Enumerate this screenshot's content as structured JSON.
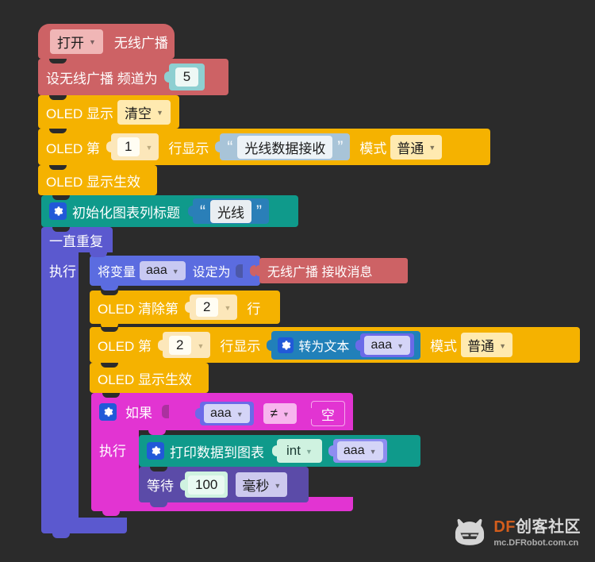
{
  "workspace": {
    "background_color": "#2b2b2b"
  },
  "blocks": {
    "radio_on": {
      "state_label": "打开",
      "title": "无线广播",
      "color": "#cd6265"
    },
    "radio_channel": {
      "prefix": "设无线广播  频道为",
      "channel": "5",
      "color": "#cd6265",
      "socket_color": "#8ecfd1"
    },
    "oled_display": {
      "prefix": "OLED 显示",
      "mode": "清空",
      "color": "#f5b200"
    },
    "oled_line1": {
      "prefix": "OLED 第",
      "line": "1",
      "mid": "行显示",
      "text": "光线数据接收",
      "mode_label": "模式",
      "mode": "普通",
      "color": "#f5b200",
      "string_color": "#a8c4d8"
    },
    "oled_flush1": {
      "label": "OLED 显示生效",
      "color": "#f5b200"
    },
    "chart_init": {
      "label": "初始化图表列标题",
      "title": "光线",
      "color": "#0f9a8b",
      "string_color": "#2a7fb8"
    },
    "repeat_forever": {
      "label": "一直重复",
      "do_label": "执行",
      "color": "#5b59cf"
    },
    "set_variable": {
      "prefix": "将变量",
      "variable": "aaa",
      "mid": "设定为",
      "color": "#5b6ce0",
      "field_color": "#c8c9f2"
    },
    "radio_receive": {
      "label": "无线广播  接收消息",
      "color": "#cd6265"
    },
    "oled_clear_line": {
      "prefix": "OLED 清除第",
      "line": "2",
      "suffix": "行",
      "color": "#f5b200"
    },
    "oled_line2": {
      "prefix": "OLED 第",
      "line": "2",
      "mid": "行显示",
      "mode_label": "模式",
      "mode": "普通",
      "color": "#f5b200"
    },
    "to_text": {
      "label": "转为文本",
      "variable": "aaa",
      "color": "#2180b9",
      "var_color": "#6b6ae8"
    },
    "oled_flush2": {
      "label": "OLED 显示生效",
      "color": "#f5b200"
    },
    "if_block": {
      "label": "如果",
      "do_label": "执行",
      "color": "#e234d2"
    },
    "compare": {
      "variable": "aaa",
      "operator": "≠",
      "empty_value": "空",
      "var_color": "#6b6ae8",
      "op_color": "#f7b5ee"
    },
    "print_chart": {
      "label": "打印数据到图表",
      "type_cast": "int",
      "variable": "aaa",
      "color": "#0f9a8b",
      "cast_color": "#cff2e0",
      "var_color": "#8e8df0"
    },
    "wait": {
      "label": "等待",
      "duration": "100",
      "unit": "毫秒",
      "color": "#5b4ba8",
      "number_color": "#cff2e0",
      "unit_color": "#cdc9ee"
    }
  },
  "watermark": {
    "brand_df": "DF",
    "brand_cn": "创客社区",
    "url": "mc.DFRobot.com.cn"
  }
}
